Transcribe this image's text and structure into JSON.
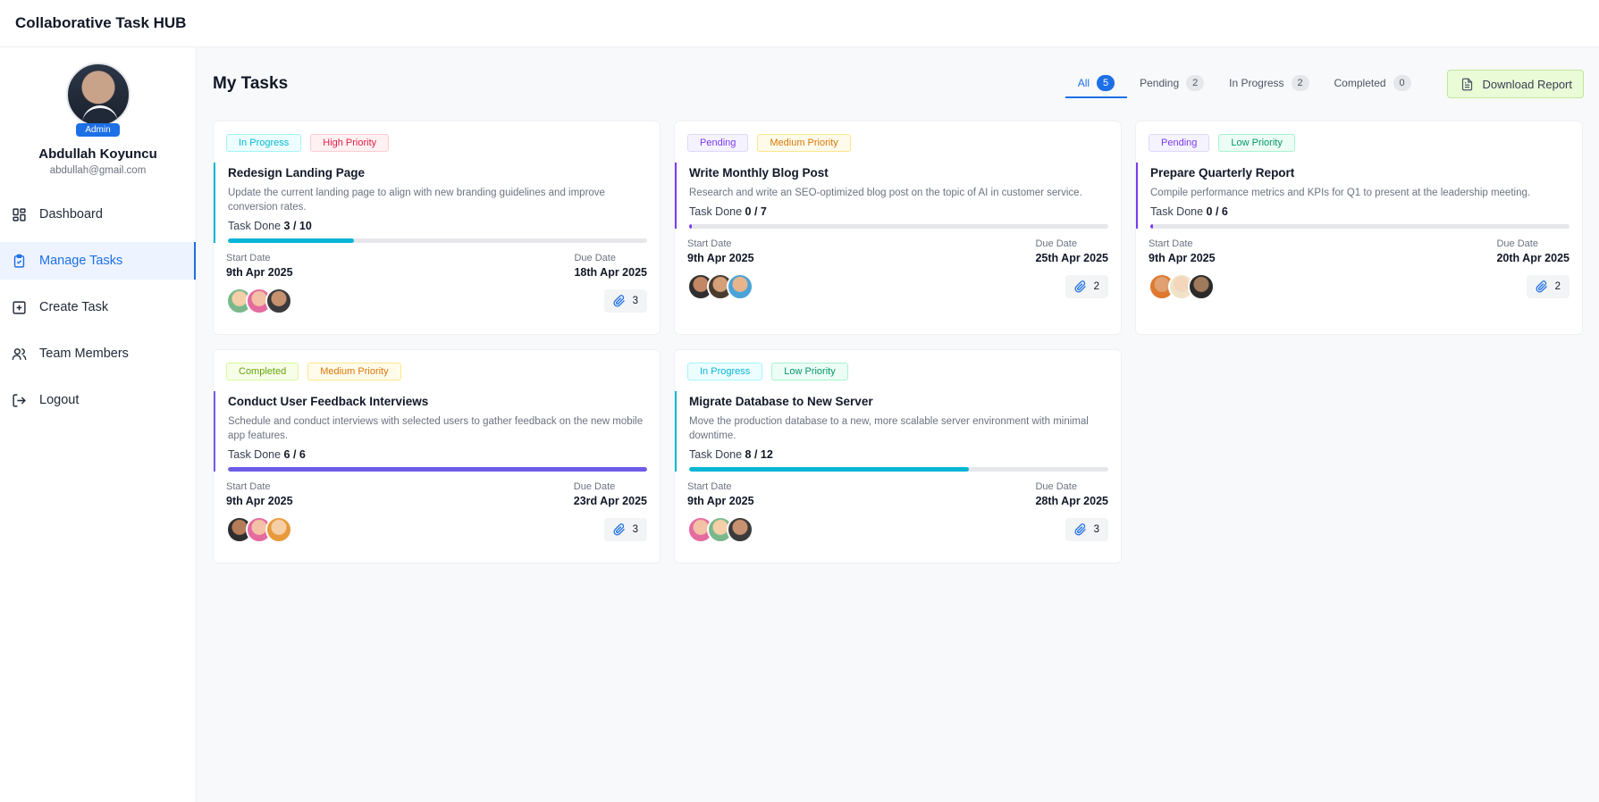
{
  "app": {
    "title": "Collaborative Task HUB"
  },
  "user": {
    "name": "Abdullah Koyuncu",
    "email": "abdullah@gmail.com",
    "role": "Admin"
  },
  "nav": [
    {
      "label": "Dashboard",
      "icon": "dashboard-icon",
      "active": false
    },
    {
      "label": "Manage Tasks",
      "icon": "clipboard-check-icon",
      "active": true
    },
    {
      "label": "Create Task",
      "icon": "plus-square-icon",
      "active": false
    },
    {
      "label": "Team Members",
      "icon": "users-icon",
      "active": false
    },
    {
      "label": "Logout",
      "icon": "logout-icon",
      "active": false
    }
  ],
  "page": {
    "title": "My Tasks"
  },
  "tabs": [
    {
      "label": "All",
      "count": "5",
      "active": true
    },
    {
      "label": "Pending",
      "count": "2",
      "active": false
    },
    {
      "label": "In Progress",
      "count": "2",
      "active": false
    },
    {
      "label": "Completed",
      "count": "0",
      "active": false
    }
  ],
  "download": {
    "label": "Download Report",
    "icon": "file-report-icon"
  },
  "labels": {
    "task_done": "Task Done",
    "start_date": "Start Date",
    "due_date": "Due Date"
  },
  "colors": {
    "accent": "#1d6fe6",
    "in_progress": "#06b6d4",
    "pending": "#7c3aed",
    "completed": "#6d5ce8"
  },
  "tasks": [
    {
      "status": "In Progress",
      "priority": "High Priority",
      "title": "Redesign Landing Page",
      "description": "Update the current landing page to align with new branding guidelines and improve conversion rates.",
      "done": "3 / 10",
      "progress": 0.3,
      "start": "9th Apr 2025",
      "due": "18th Apr 2025",
      "attachments": "3"
    },
    {
      "status": "Pending",
      "priority": "Medium Priority",
      "title": "Write Monthly Blog Post",
      "description": "Research and write an SEO-optimized blog post on the topic of AI in customer service.",
      "done": "0 / 7",
      "progress": 0.0,
      "start": "9th Apr 2025",
      "due": "25th Apr 2025",
      "attachments": "2"
    },
    {
      "status": "Pending",
      "priority": "Low Priority",
      "title": "Prepare Quarterly Report",
      "description": "Compile performance metrics and KPIs for Q1 to present at the leadership meeting.",
      "done": "0 / 6",
      "progress": 0.0,
      "start": "9th Apr 2025",
      "due": "20th Apr 2025",
      "attachments": "2"
    },
    {
      "status": "Completed",
      "priority": "Medium Priority",
      "title": "Conduct User Feedback Interviews",
      "description": "Schedule and conduct interviews with selected users to gather feedback on the new mobile app features.",
      "done": "6 / 6",
      "progress": 1.0,
      "start": "9th Apr 2025",
      "due": "23rd Apr 2025",
      "attachments": "3"
    },
    {
      "status": "In Progress",
      "priority": "Low Priority",
      "title": "Migrate Database to New Server",
      "description": "Move the production database to a new, more scalable server environment with minimal downtime.",
      "done": "8 / 12",
      "progress": 0.667,
      "start": "9th Apr 2025",
      "due": "28th Apr 2025",
      "attachments": "3"
    }
  ]
}
